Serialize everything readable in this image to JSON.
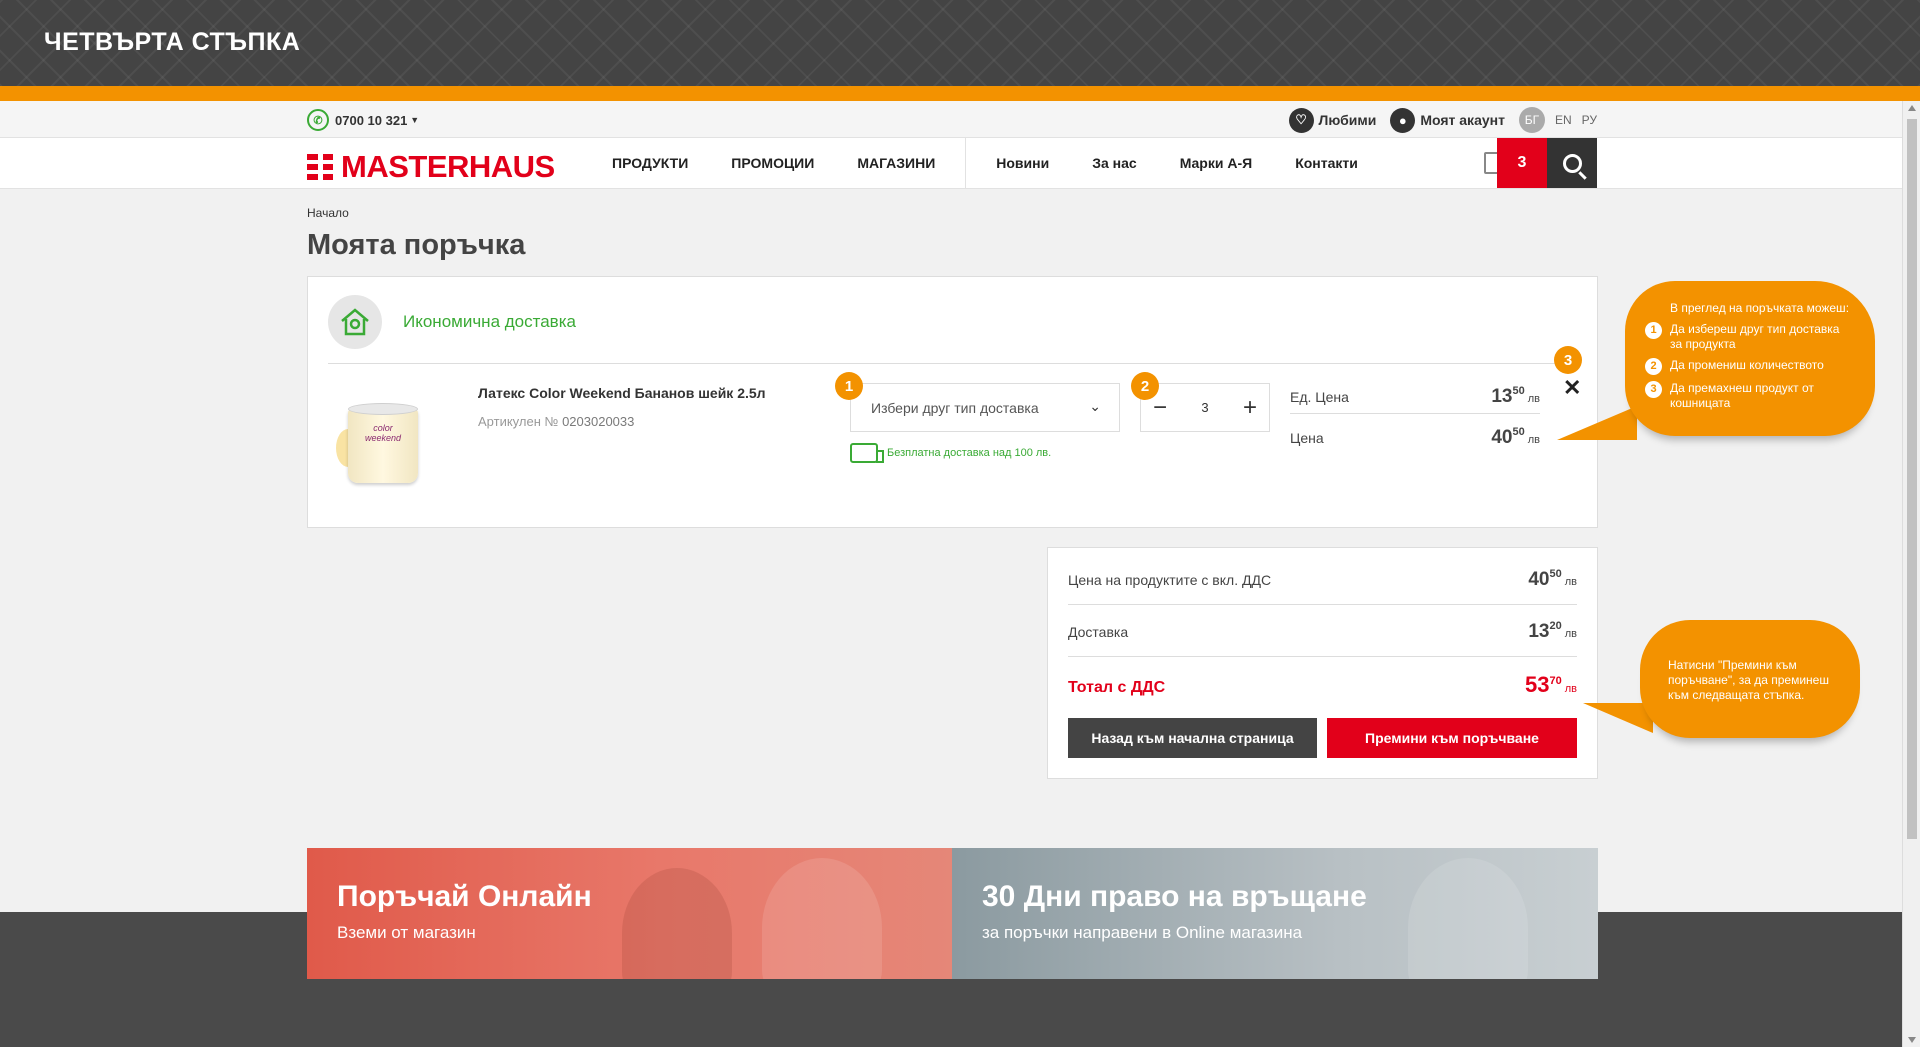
{
  "step_banner": {
    "title": "ЧЕТВЪРТА СТЪПКА"
  },
  "header": {
    "phone": "0700 10 321",
    "favorites": "Любими",
    "account": "Моят акаунт",
    "languages": [
      "БГ",
      "EN",
      "РУ"
    ]
  },
  "nav": {
    "logo": "MASTERHAUS",
    "primary": [
      "ПРОДУКТИ",
      "ПРОМОЦИИ",
      "МАГАЗИНИ"
    ],
    "secondary": [
      "Новини",
      "За нас",
      "Марки А-Я",
      "Контакти"
    ],
    "cart_count": "3"
  },
  "breadcrumb": "Начало",
  "page_title": "Моята поръчка",
  "order": {
    "delivery_title": "Икономична доставка",
    "product_name": "Латекс Color Weekend Бананов шейк 2.5л",
    "sku_label": "Артикулен №",
    "sku": "0203020033",
    "delivery_select": "Избери друг тип доставка",
    "free_shipping": "Безплатна доставка над 100 лв.",
    "quantity": "3",
    "unit_price_label": "Ед. Цена",
    "unit_price_int": "13",
    "unit_price_dec": "50",
    "price_label": "Цена",
    "price_int": "40",
    "price_dec": "50",
    "currency": "лв",
    "can_label": "color weekend"
  },
  "summary": {
    "products_label": "Цена на продуктите с вкл. ДДС",
    "products_int": "40",
    "products_dec": "50",
    "delivery_label": "Доставка",
    "delivery_int": "13",
    "delivery_dec": "20",
    "total_label": "Тотал с ДДС",
    "total_int": "53",
    "total_dec": "70",
    "currency": "лв",
    "back_button": "Назад към начална страница",
    "next_button": "Премини към поръчване"
  },
  "badges": [
    "1",
    "2",
    "3"
  ],
  "tooltip1": {
    "heading": "В преглед на поръчката можеш:",
    "items": [
      "Да избереш друг тип доставка за продукта",
      "Да промениш количеството",
      "Да премахнеш продукт от кошницата"
    ]
  },
  "tooltip2": {
    "text": "Натисни \"Премини към поръчване\", за да преминеш към следващата стъпка."
  },
  "promos": [
    {
      "title": "Поръчай Онлайн",
      "subtitle": "Вземи от магазин"
    },
    {
      "title": "30 Дни право на връщане",
      "subtitle": "за поръчки направени в Online магазина"
    }
  ],
  "colors": {
    "brand_red": "#e2001a",
    "accent_orange": "#f39200",
    "green": "#3aaa35",
    "dark": "#444444"
  }
}
